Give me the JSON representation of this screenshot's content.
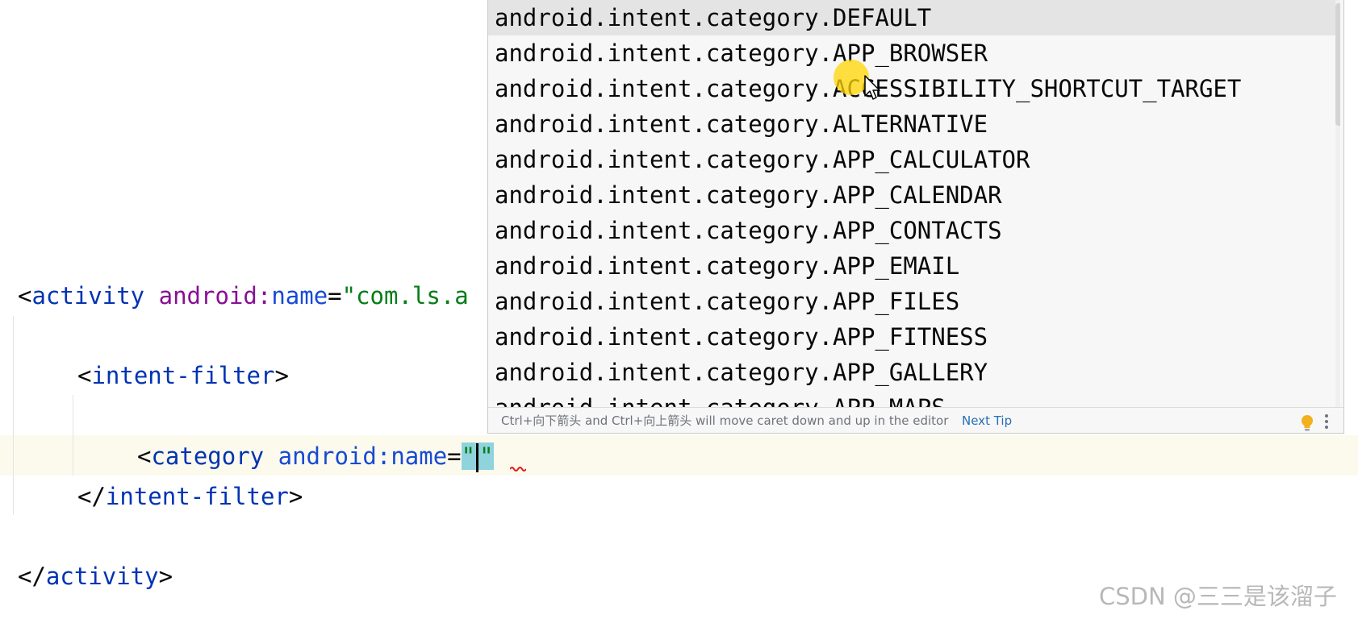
{
  "editor": {
    "line1": {
      "open": "<",
      "tag": "activity",
      "attr": "android:",
      "attrname": "name",
      "eq": "=",
      "value": "\"com.ls.a"
    },
    "line2": {
      "open": "<",
      "tag": "intent-filter",
      "close": ">"
    },
    "line3": {
      "open": "<",
      "tag": "category",
      "attr": "android:",
      "attrname": "name",
      "eq": "=",
      "q1": "\"",
      "q2": "\""
    },
    "line4": {
      "open": "</",
      "tag": "intent-filter",
      "close": ">"
    },
    "line5": {
      "open": "</",
      "tag": "activity",
      "close": ">"
    }
  },
  "completion": {
    "items": [
      "android.intent.category.DEFAULT",
      "android.intent.category.APP_BROWSER",
      "android.intent.category.ACCESSIBILITY_SHORTCUT_TARGET",
      "android.intent.category.ALTERNATIVE",
      "android.intent.category.APP_CALCULATOR",
      "android.intent.category.APP_CALENDAR",
      "android.intent.category.APP_CONTACTS",
      "android.intent.category.APP_EMAIL",
      "android.intent.category.APP_FILES",
      "android.intent.category.APP_FITNESS",
      "android.intent.category.APP_GALLERY",
      "android.intent.category.APP_MAPS"
    ],
    "selected_index": 0,
    "footer_hint": "Ctrl+向下箭头 and Ctrl+向上箭头 will move caret down and up in the editor",
    "footer_link": "Next Tip"
  },
  "watermark": "CSDN @三三是该溜子",
  "colors": {
    "tag": "#0033b3",
    "attr": "#871094",
    "value": "#067d17",
    "selection": "#e4e4e4",
    "cursor_highlight": "#ffd500"
  },
  "icons": [
    "lightbulb-icon",
    "more-vertical-icon",
    "mouse-pointer-icon"
  ]
}
